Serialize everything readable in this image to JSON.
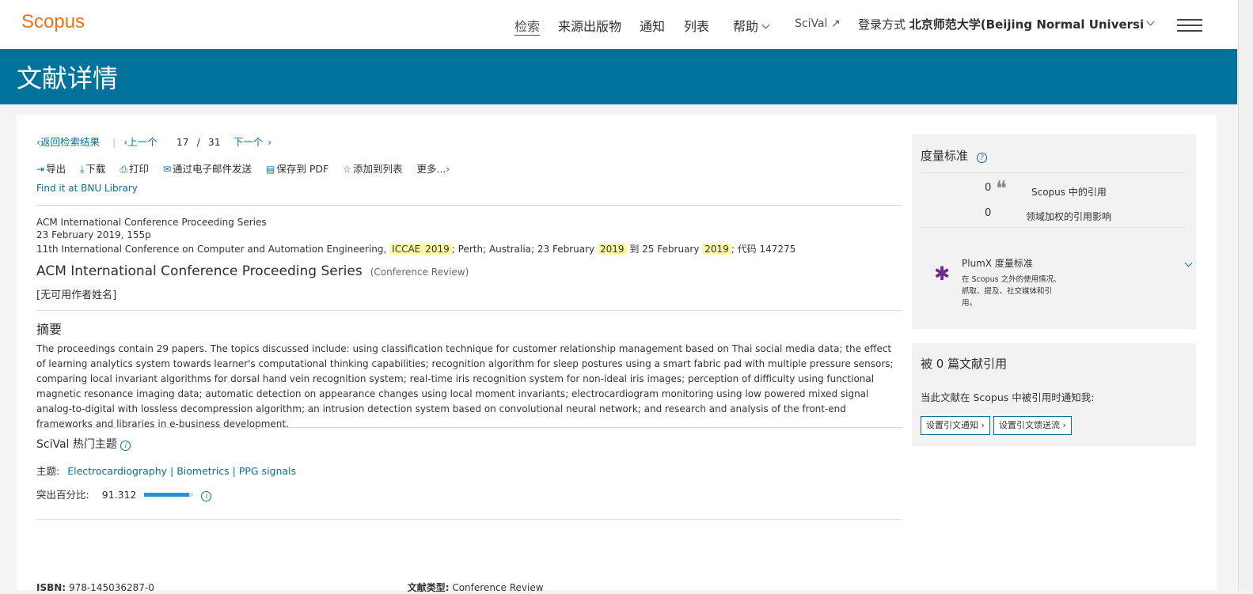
{
  "header": {
    "logo": "Scopus",
    "nav": [
      "检索",
      "来源出版物",
      "通知",
      "列表",
      "帮助",
      "SciVal ↗"
    ],
    "login_prefix": "登录方式",
    "login_institution": "北京师范大学(Beijing Normal Universi"
  },
  "banner": {
    "title": "文献详情"
  },
  "nav_row": {
    "back": "返回检索结果",
    "prev": "上一个",
    "position": "17",
    "separator": "/",
    "total": "31",
    "next": "下一个"
  },
  "toolbar": {
    "export": "导出",
    "download": "下载",
    "print": "打印",
    "email": "通过电子邮件发送",
    "pdf": "保存到 PDF",
    "add_list": "添加到列表",
    "more": "更多..."
  },
  "findit": "Find it at BNU Library",
  "source": {
    "series": "ACM International Conference Proceeding Series",
    "date_pages": "23 February 2019, 155p",
    "conf_text1": "11th International Conference on Computer and Automation Engineering,",
    "conf_hl1": "ICCAE",
    "conf_hl2": "2019",
    "conf_text2": "; Perth; Australia; 23 February",
    "conf_hl3": "2019",
    "conf_text3": "到 25 February",
    "conf_hl4": "2019",
    "conf_text4": "; 代码 147275"
  },
  "doc": {
    "title": "ACM International Conference Proceeding Series",
    "type": "(Conference Review)",
    "authors": "[无可用作者姓名]"
  },
  "abstract": {
    "heading": "摘要",
    "text": "The proceedings contain 29 papers. The topics discussed include: using classification technique for customer relationship management based on Thai social media data; the effect of learning analytics system towards learner's computational thinking capabilities; recognition algorithm for sleep postures using a smart fabric pad with multiple pressure sensors; comparing local invariant algorithms for dorsal hand vein recognition system; real-time iris recognition system for non-ideal iris images; perception of difficulty using functional magnetic resonance imaging data; automatic detection on appearance changes using local moment invariants; electrocardiogram monitoring using low powered mixed signal analog-to-digital with lossless decompression algorithm; an intrusion detection system based on convolutional neural network; and research and analysis of the front-end frameworks and libraries in e-business development."
  },
  "scival": {
    "heading": "SciVal 热门主题",
    "topic_label": "主题:",
    "topics": "Electrocardiography | Biometrics | PPG signals",
    "pct_label": "突出百分比:",
    "pct_value": "91.312",
    "pct_fraction": 0.91312
  },
  "bottom": {
    "isbn_label": "ISBN:",
    "isbn_value": "978-145036287-0",
    "doctype_label": "文献类型:",
    "doctype_value": "Conference Review"
  },
  "metrics": {
    "heading": "度量标准",
    "citations_count": "0",
    "citations_label": "Scopus 中的引用",
    "fwci_count": "0",
    "fwci_label": "领域加权的引用影响",
    "plumx_title": "PlumX 度量标准",
    "plumx_desc1": "在 Scopus 之外的使用情况、",
    "plumx_desc2": "抓取、提及、社交媒体和引",
    "plumx_desc3": "用。"
  },
  "cited": {
    "heading": "被 0 篇文献引用",
    "notify_text": "当此文献在 Scopus 中被引用时通知我:",
    "btn_alert": "设置引文通知 ›",
    "btn_feed": "设置引文馈送流 ›"
  },
  "colors": {
    "accent": "#00729b",
    "logo": "#e9711c",
    "highlight": "#fff7a8",
    "link": "#0a6e9a"
  }
}
